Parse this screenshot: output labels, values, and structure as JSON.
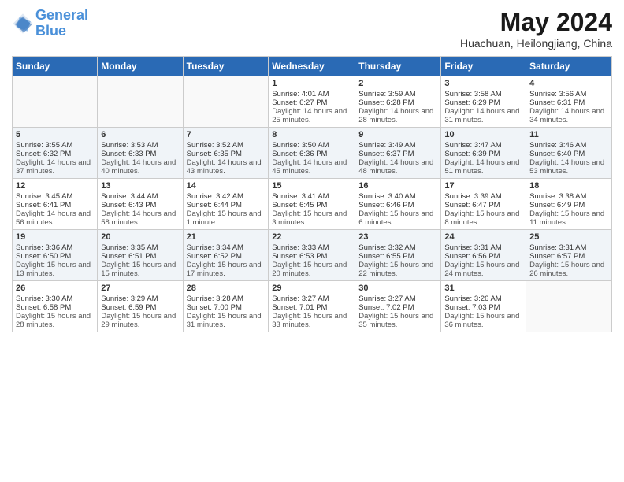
{
  "header": {
    "logo_line1": "General",
    "logo_line2": "Blue",
    "month_title": "May 2024",
    "location": "Huachuan, Heilongjiang, China"
  },
  "days_of_week": [
    "Sunday",
    "Monday",
    "Tuesday",
    "Wednesday",
    "Thursday",
    "Friday",
    "Saturday"
  ],
  "weeks": [
    [
      {
        "day": "",
        "sunrise": "",
        "sunset": "",
        "daylight": ""
      },
      {
        "day": "",
        "sunrise": "",
        "sunset": "",
        "daylight": ""
      },
      {
        "day": "",
        "sunrise": "",
        "sunset": "",
        "daylight": ""
      },
      {
        "day": "1",
        "sunrise": "Sunrise: 4:01 AM",
        "sunset": "Sunset: 6:27 PM",
        "daylight": "Daylight: 14 hours and 25 minutes."
      },
      {
        "day": "2",
        "sunrise": "Sunrise: 3:59 AM",
        "sunset": "Sunset: 6:28 PM",
        "daylight": "Daylight: 14 hours and 28 minutes."
      },
      {
        "day": "3",
        "sunrise": "Sunrise: 3:58 AM",
        "sunset": "Sunset: 6:29 PM",
        "daylight": "Daylight: 14 hours and 31 minutes."
      },
      {
        "day": "4",
        "sunrise": "Sunrise: 3:56 AM",
        "sunset": "Sunset: 6:31 PM",
        "daylight": "Daylight: 14 hours and 34 minutes."
      }
    ],
    [
      {
        "day": "5",
        "sunrise": "Sunrise: 3:55 AM",
        "sunset": "Sunset: 6:32 PM",
        "daylight": "Daylight: 14 hours and 37 minutes."
      },
      {
        "day": "6",
        "sunrise": "Sunrise: 3:53 AM",
        "sunset": "Sunset: 6:33 PM",
        "daylight": "Daylight: 14 hours and 40 minutes."
      },
      {
        "day": "7",
        "sunrise": "Sunrise: 3:52 AM",
        "sunset": "Sunset: 6:35 PM",
        "daylight": "Daylight: 14 hours and 43 minutes."
      },
      {
        "day": "8",
        "sunrise": "Sunrise: 3:50 AM",
        "sunset": "Sunset: 6:36 PM",
        "daylight": "Daylight: 14 hours and 45 minutes."
      },
      {
        "day": "9",
        "sunrise": "Sunrise: 3:49 AM",
        "sunset": "Sunset: 6:37 PM",
        "daylight": "Daylight: 14 hours and 48 minutes."
      },
      {
        "day": "10",
        "sunrise": "Sunrise: 3:47 AM",
        "sunset": "Sunset: 6:39 PM",
        "daylight": "Daylight: 14 hours and 51 minutes."
      },
      {
        "day": "11",
        "sunrise": "Sunrise: 3:46 AM",
        "sunset": "Sunset: 6:40 PM",
        "daylight": "Daylight: 14 hours and 53 minutes."
      }
    ],
    [
      {
        "day": "12",
        "sunrise": "Sunrise: 3:45 AM",
        "sunset": "Sunset: 6:41 PM",
        "daylight": "Daylight: 14 hours and 56 minutes."
      },
      {
        "day": "13",
        "sunrise": "Sunrise: 3:44 AM",
        "sunset": "Sunset: 6:43 PM",
        "daylight": "Daylight: 14 hours and 58 minutes."
      },
      {
        "day": "14",
        "sunrise": "Sunrise: 3:42 AM",
        "sunset": "Sunset: 6:44 PM",
        "daylight": "Daylight: 15 hours and 1 minute."
      },
      {
        "day": "15",
        "sunrise": "Sunrise: 3:41 AM",
        "sunset": "Sunset: 6:45 PM",
        "daylight": "Daylight: 15 hours and 3 minutes."
      },
      {
        "day": "16",
        "sunrise": "Sunrise: 3:40 AM",
        "sunset": "Sunset: 6:46 PM",
        "daylight": "Daylight: 15 hours and 6 minutes."
      },
      {
        "day": "17",
        "sunrise": "Sunrise: 3:39 AM",
        "sunset": "Sunset: 6:47 PM",
        "daylight": "Daylight: 15 hours and 8 minutes."
      },
      {
        "day": "18",
        "sunrise": "Sunrise: 3:38 AM",
        "sunset": "Sunset: 6:49 PM",
        "daylight": "Daylight: 15 hours and 11 minutes."
      }
    ],
    [
      {
        "day": "19",
        "sunrise": "Sunrise: 3:36 AM",
        "sunset": "Sunset: 6:50 PM",
        "daylight": "Daylight: 15 hours and 13 minutes."
      },
      {
        "day": "20",
        "sunrise": "Sunrise: 3:35 AM",
        "sunset": "Sunset: 6:51 PM",
        "daylight": "Daylight: 15 hours and 15 minutes."
      },
      {
        "day": "21",
        "sunrise": "Sunrise: 3:34 AM",
        "sunset": "Sunset: 6:52 PM",
        "daylight": "Daylight: 15 hours and 17 minutes."
      },
      {
        "day": "22",
        "sunrise": "Sunrise: 3:33 AM",
        "sunset": "Sunset: 6:53 PM",
        "daylight": "Daylight: 15 hours and 20 minutes."
      },
      {
        "day": "23",
        "sunrise": "Sunrise: 3:32 AM",
        "sunset": "Sunset: 6:55 PM",
        "daylight": "Daylight: 15 hours and 22 minutes."
      },
      {
        "day": "24",
        "sunrise": "Sunrise: 3:31 AM",
        "sunset": "Sunset: 6:56 PM",
        "daylight": "Daylight: 15 hours and 24 minutes."
      },
      {
        "day": "25",
        "sunrise": "Sunrise: 3:31 AM",
        "sunset": "Sunset: 6:57 PM",
        "daylight": "Daylight: 15 hours and 26 minutes."
      }
    ],
    [
      {
        "day": "26",
        "sunrise": "Sunrise: 3:30 AM",
        "sunset": "Sunset: 6:58 PM",
        "daylight": "Daylight: 15 hours and 28 minutes."
      },
      {
        "day": "27",
        "sunrise": "Sunrise: 3:29 AM",
        "sunset": "Sunset: 6:59 PM",
        "daylight": "Daylight: 15 hours and 29 minutes."
      },
      {
        "day": "28",
        "sunrise": "Sunrise: 3:28 AM",
        "sunset": "Sunset: 7:00 PM",
        "daylight": "Daylight: 15 hours and 31 minutes."
      },
      {
        "day": "29",
        "sunrise": "Sunrise: 3:27 AM",
        "sunset": "Sunset: 7:01 PM",
        "daylight": "Daylight: 15 hours and 33 minutes."
      },
      {
        "day": "30",
        "sunrise": "Sunrise: 3:27 AM",
        "sunset": "Sunset: 7:02 PM",
        "daylight": "Daylight: 15 hours and 35 minutes."
      },
      {
        "day": "31",
        "sunrise": "Sunrise: 3:26 AM",
        "sunset": "Sunset: 7:03 PM",
        "daylight": "Daylight: 15 hours and 36 minutes."
      },
      {
        "day": "",
        "sunrise": "",
        "sunset": "",
        "daylight": ""
      }
    ]
  ]
}
